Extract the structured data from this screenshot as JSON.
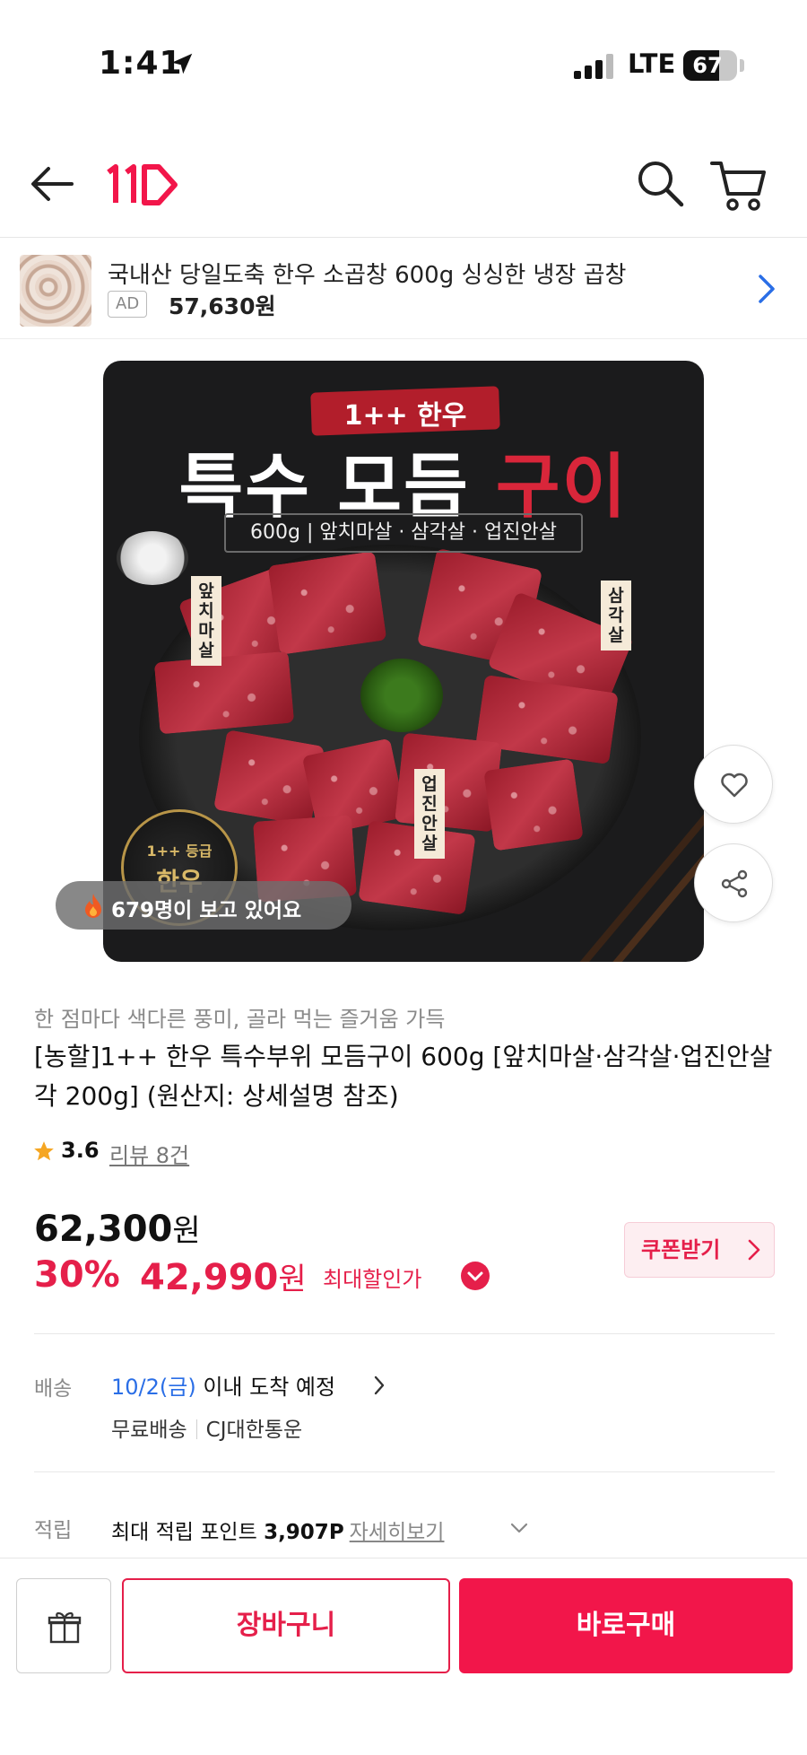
{
  "status_bar": {
    "time": "1:41",
    "network": "LTE",
    "battery": "67",
    "battery_level": 0.67
  },
  "header": {
    "logo_text": "11"
  },
  "ad_banner": {
    "title": "국내산 당일도축 한우 소곱창 600g 싱싱한 냉장 곱창",
    "badge": "AD",
    "price": "57,630원"
  },
  "product_image": {
    "badge": "1++ 한우",
    "title_main": "특수 모듬",
    "title_accent": "구이",
    "subtitle": "600g | 앞치마살 · 삼각살 · 업진안살",
    "cuts": [
      "앞치마살",
      "삼각살",
      "업진안살"
    ],
    "seal_top": "1++ 등급",
    "seal_bottom": "한우"
  },
  "viewer_badge": "679명이 보고 있어요",
  "product": {
    "subtitle": "한 점마다 색다른 풍미, 골라 먹는 즐거움 가득",
    "title": "[농할]1++ 한우 특수부위 모듬구이 600g [앞치마살·삼각살·업진안살 각 200g] (원산지: 상세설명 참조)",
    "rating": "3.6",
    "review_count": "리뷰 8건"
  },
  "price": {
    "original": "62,300",
    "won": "원",
    "discount_rate": "30%",
    "sale": "42,990",
    "max_discount_label": "최대할인가",
    "coupon_label": "쿠폰받기"
  },
  "shipping": {
    "label": "배송",
    "date": "10/2(금)",
    "date_suffix": " 이내 도착 예정",
    "fee": "무료배송",
    "carrier": "CJ대한통운"
  },
  "points": {
    "label": "적립",
    "text": "최대 적립 포인트",
    "value": "3,907P",
    "link": "자세히보기"
  },
  "bottom_bar": {
    "cart_label": "장바구니",
    "buy_label": "바로구매"
  },
  "colors": {
    "accent": "#e51f4a",
    "link_blue": "#2a6ee6"
  }
}
